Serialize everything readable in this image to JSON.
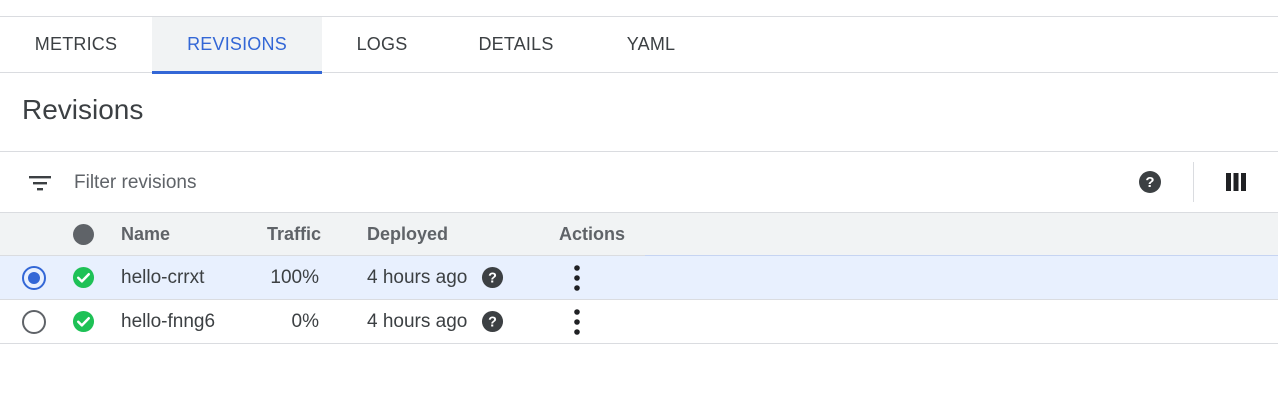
{
  "tabs": [
    {
      "label": "METRICS",
      "active": false
    },
    {
      "label": "REVISIONS",
      "active": true
    },
    {
      "label": "LOGS",
      "active": false
    },
    {
      "label": "DETAILS",
      "active": false
    },
    {
      "label": "YAML",
      "active": false
    }
  ],
  "section": {
    "title": "Revisions"
  },
  "filter": {
    "placeholder": "Filter revisions",
    "value": ""
  },
  "table": {
    "columns": {
      "name": "Name",
      "traffic": "Traffic",
      "deployed": "Deployed",
      "actions": "Actions"
    },
    "rows": [
      {
        "selected": true,
        "status": "ok",
        "name": "hello-crrxt",
        "traffic": "100%",
        "deployed": "4 hours ago"
      },
      {
        "selected": false,
        "status": "ok",
        "name": "hello-fnng6",
        "traffic": "0%",
        "deployed": "4 hours ago"
      }
    ]
  },
  "icons": {
    "filter": "filter-list-icon",
    "help": "help-circle-icon",
    "columns": "view-column-icon",
    "status": "check-circle-icon",
    "more": "more-vert-icon"
  },
  "colors": {
    "accent": "#3367d6",
    "success": "#1ec156",
    "selected_row_bg": "#e8f0fe",
    "header_bg": "#f1f3f4"
  }
}
